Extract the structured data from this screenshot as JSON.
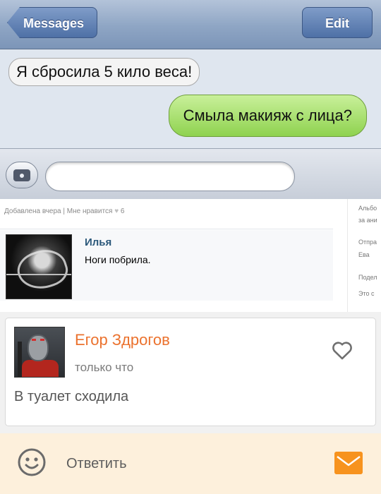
{
  "ios_messages": {
    "back_label": "Messages",
    "edit_label": "Edit",
    "incoming_message": "Я сбросила 5 кило веса!",
    "outgoing_message": "Смыла макияж с лица?",
    "input_value": ""
  },
  "vk_post": {
    "meta_added": "Добавлена вчера",
    "meta_separator": "|",
    "meta_like": "Мне нравится",
    "like_icon": "heart-icon",
    "like_count": "6",
    "comment_author": "Илья",
    "comment_text": "Ноги побрила.",
    "sidebar_items": [
      "Альбо",
      "за ани",
      "Отпра",
      "Ева",
      "Подел",
      "Это с"
    ]
  },
  "ok_comment": {
    "author": "Егор Здрогов",
    "time": "только что",
    "text": "В туалет сходила",
    "like_icon": "heart-outline-icon",
    "name_color": "#eb722e"
  },
  "reply_bar": {
    "label": "Ответить",
    "emoji_icon": "smile-icon",
    "send_icon": "mail-icon",
    "accent": "#f7931e"
  }
}
